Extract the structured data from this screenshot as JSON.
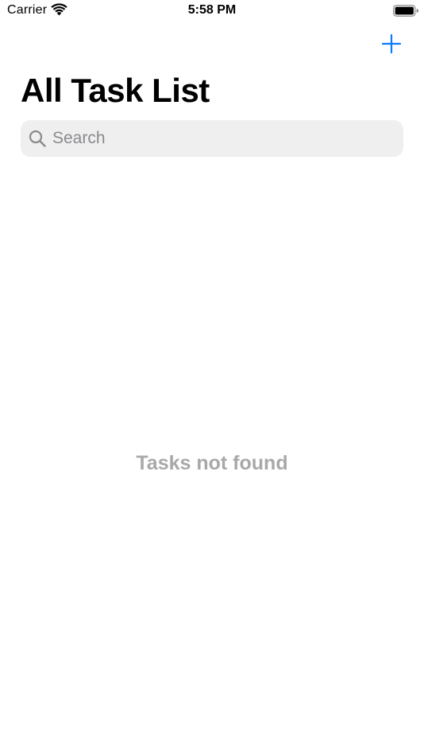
{
  "status_bar": {
    "carrier": "Carrier",
    "time": "5:58 PM",
    "wifi_icon": "wifi-icon",
    "battery_icon": "battery-icon"
  },
  "nav": {
    "add_icon": "plus-icon",
    "accent_color": "#0a7aff"
  },
  "header": {
    "title": "All Task List"
  },
  "search": {
    "placeholder": "Search",
    "value": "",
    "icon": "search-icon",
    "background_color": "#efeff0"
  },
  "main": {
    "empty_message": "Tasks not found",
    "empty_color": "#a8a8a8"
  }
}
